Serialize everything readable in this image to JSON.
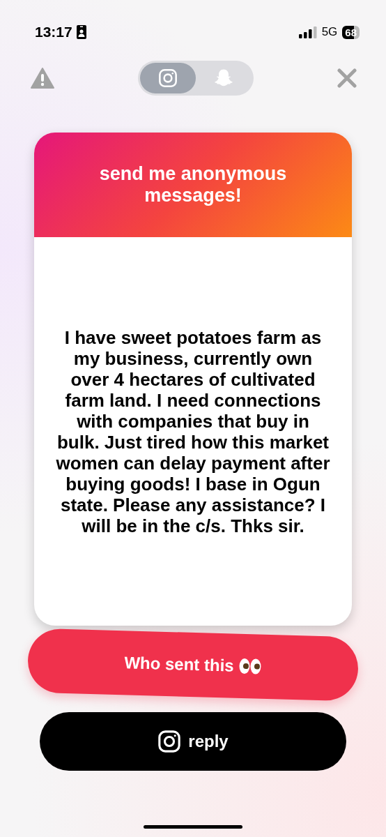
{
  "status_bar": {
    "time": "13:17",
    "network": "5G",
    "battery": "68"
  },
  "share_tabs": [
    {
      "kind": "instagram",
      "selected": true
    },
    {
      "kind": "snapchat",
      "selected": false
    }
  ],
  "card": {
    "title": "send me anonymous messages!",
    "message": "I have sweet potatoes farm as my business, currently own over 4 hectares of cultivated farm land. I need connections with companies that buy in bulk. Just tired how this market women can delay payment after buying goods!  I base in Ogun state. Please any assistance? I will be in the c/s. Thks sir."
  },
  "who_button": {
    "label": "Who sent this"
  },
  "reply_button": {
    "label": "reply"
  }
}
